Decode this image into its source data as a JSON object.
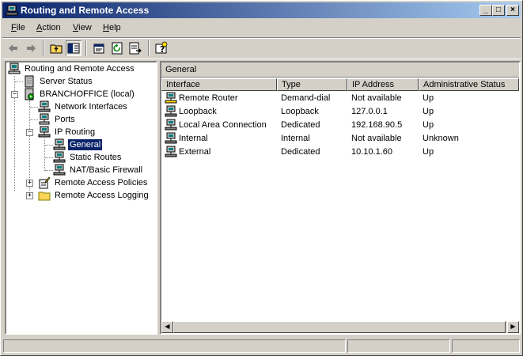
{
  "window": {
    "title": "Routing and Remote Access",
    "controls": {
      "minimize": "_",
      "maximize": "□",
      "close": "×"
    }
  },
  "menu": [
    {
      "label": "File",
      "key": "F",
      "rest": "ile"
    },
    {
      "label": "Action",
      "key": "A",
      "rest": "ction"
    },
    {
      "label": "View",
      "key": "V",
      "rest": "iew"
    },
    {
      "label": "Help",
      "key": "H",
      "rest": "elp"
    }
  ],
  "toolbar": {
    "back_icon": "back-arrow-icon",
    "forward_icon": "forward-arrow-icon",
    "up_icon": "up-folder-icon",
    "show_tree_icon": "show-hide-tree-icon",
    "properties_icon": "properties-icon",
    "refresh_icon": "refresh-icon",
    "export_icon": "export-list-icon",
    "help_icon": "help-icon"
  },
  "tree": {
    "root": "Routing and Remote Access",
    "server_status": "Server Status",
    "server": "BRANCHOFFICE (local)",
    "network_interfaces": "Network Interfaces",
    "ports": "Ports",
    "ip_routing": "IP Routing",
    "general": "General",
    "static_routes": "Static Routes",
    "nat": "NAT/Basic Firewall",
    "policies": "Remote Access Policies",
    "logging": "Remote Access Logging",
    "expand_minus": "−",
    "expand_plus": "+"
  },
  "pane": {
    "title": "General",
    "columns": [
      "Interface",
      "Type",
      "IP Address",
      "Administrative Status"
    ],
    "sort_arrow": "▽",
    "rows": [
      {
        "interface": "Remote Router",
        "type": "Demand-dial",
        "ip": "Not available",
        "status": "Up",
        "icon": "demand-dial-icon"
      },
      {
        "interface": "Loopback",
        "type": "Loopback",
        "ip": "127.0.0.1",
        "status": "Up",
        "icon": "network-interface-icon"
      },
      {
        "interface": "Local Area Connection",
        "type": "Dedicated",
        "ip": "192.168.90.5",
        "status": "Up",
        "icon": "network-interface-icon"
      },
      {
        "interface": "Internal",
        "type": "Internal",
        "ip": "Not available",
        "status": "Unknown",
        "icon": "network-interface-icon"
      },
      {
        "interface": "External",
        "type": "Dedicated",
        "ip": "10.10.1.60",
        "status": "Up",
        "icon": "network-interface-icon"
      }
    ],
    "scroll_left": "◀",
    "scroll_right": "▶"
  }
}
